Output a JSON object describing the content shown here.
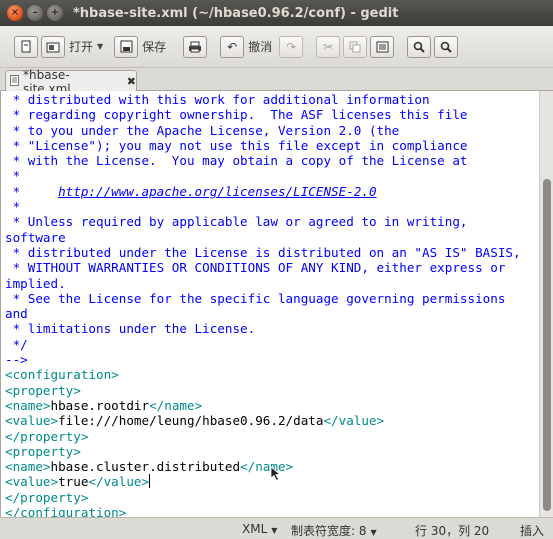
{
  "window": {
    "title": "*hbase-site.xml (~/hbase0.96.2/conf) - gedit",
    "controls": {
      "close": "×",
      "minimize": "–",
      "maximize": "+"
    }
  },
  "toolbar": {
    "new_icon": "new-document-icon",
    "open_label": "打开",
    "save_label": "保存",
    "undo_label": "撤消",
    "buttons": [
      "new",
      "open",
      "save",
      "print",
      "undo",
      "redo",
      "cut",
      "copy",
      "paste",
      "find",
      "find-replace"
    ]
  },
  "tab": {
    "label": "*hbase-site.xml",
    "close": "✖"
  },
  "editor": {
    "lines": [
      {
        "type": "comment",
        "text": " * distributed with this work for additional information"
      },
      {
        "type": "comment",
        "text": " * regarding copyright ownership.  The ASF licenses this file"
      },
      {
        "type": "comment",
        "text": " * to you under the Apache License, Version 2.0 (the"
      },
      {
        "type": "comment",
        "text": " * \"License\"); you may not use this file except in compliance"
      },
      {
        "type": "comment",
        "text": " * with the License.  You may obtain a copy of the License at"
      },
      {
        "type": "comment",
        "text": " *"
      },
      {
        "type": "link",
        "prefix": " *     ",
        "text": "http://www.apache.org/licenses/LICENSE-2.0"
      },
      {
        "type": "comment",
        "text": " *"
      },
      {
        "type": "comment",
        "text": " * Unless required by applicable law or agreed to in writing,"
      },
      {
        "type": "comment",
        "text": "software"
      },
      {
        "type": "comment",
        "text": " * distributed under the License is distributed on an \"AS IS\" BASIS,"
      },
      {
        "type": "comment",
        "text": " * WITHOUT WARRANTIES OR CONDITIONS OF ANY KIND, either express or"
      },
      {
        "type": "comment",
        "text": "implied."
      },
      {
        "type": "comment",
        "text": " * See the License for the specific language governing permissions"
      },
      {
        "type": "comment",
        "text": "and"
      },
      {
        "type": "comment",
        "text": " * limitations under the License."
      },
      {
        "type": "comment",
        "text": " */"
      },
      {
        "type": "comment",
        "text": "-->"
      },
      {
        "type": "tag",
        "text": "<configuration>"
      },
      {
        "type": "tag",
        "text": "<property>"
      },
      {
        "type": "element",
        "open": "<name>",
        "value": "hbase.rootdir",
        "close": "</name>"
      },
      {
        "type": "element",
        "open": "<value>",
        "value": "file:///home/leung/hbase0.96.2/data",
        "close": "</value>"
      },
      {
        "type": "tag",
        "text": "</property>"
      },
      {
        "type": "tag",
        "text": "<property>"
      },
      {
        "type": "element",
        "open": "<name>",
        "value": "hbase.cluster.distributed",
        "close": "</name>"
      },
      {
        "type": "element",
        "open": "<value>",
        "value": "true",
        "close": "</value>",
        "cursor": true
      },
      {
        "type": "tag",
        "text": "</property>"
      },
      {
        "type": "tag",
        "text": "</configuration>"
      }
    ]
  },
  "statusbar": {
    "language": "XML",
    "tab_width": "制表符宽度: 8",
    "position": "行 30，列 20",
    "mode": "插入"
  },
  "colors": {
    "comment": "#0000ff",
    "tag": "#008a8c",
    "titlebar": "#3c3b37",
    "close_button": "#e2531d"
  }
}
